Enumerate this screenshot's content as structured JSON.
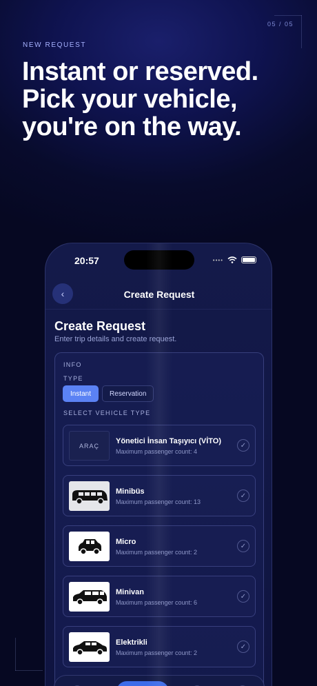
{
  "page_counter": "05 / 05",
  "eyebrow": "NEW REQUEST",
  "headline": [
    "Instant or reserved.",
    "Pick your vehicle,",
    "you're on the way."
  ],
  "phone": {
    "status_time": "20:57",
    "nav_title": "Create Request",
    "back_icon": "chevron-left-icon",
    "title": "Create Request",
    "subtitle": "Enter trip details and create request.",
    "info_label": "INFO",
    "type_label": "TYPE",
    "type_options": [
      "Instant",
      "Reservation"
    ],
    "type_selected": "Instant",
    "vehicle_label": "SELECT VEHICLE TYPE",
    "vehicles": [
      {
        "name": "Yönetici İnsan Taşıyıcı  (VİTO)",
        "capacity": "Maximum passenger count: 4",
        "thumb": "ARAÇ"
      },
      {
        "name": "Minibüs",
        "capacity": "Maximum passenger count: 13",
        "thumb": "minibus-icon"
      },
      {
        "name": "Micro",
        "capacity": "Maximum passenger count: 2",
        "thumb": "micro-car-icon"
      },
      {
        "name": "Minivan",
        "capacity": "Maximum passenger count: 6",
        "thumb": "minivan-icon"
      },
      {
        "name": "Elektrikli",
        "capacity": "Maximum passenger count: 2",
        "thumb": "electric-car-icon"
      }
    ]
  },
  "colors": {
    "accent": "#5b82f4",
    "background": "#080b2c"
  }
}
